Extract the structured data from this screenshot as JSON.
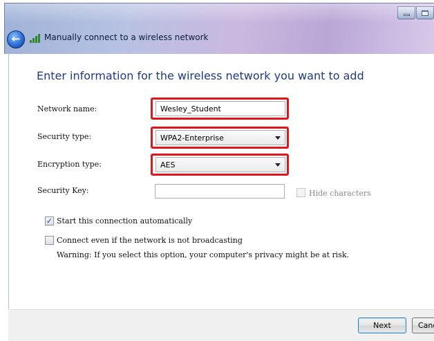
{
  "window": {
    "title": "Manually connect to a wireless network"
  },
  "form": {
    "heading": "Enter information for the wireless network you want to add",
    "network_name": {
      "label": "Network name:",
      "value": "Wesley_Student"
    },
    "security_type": {
      "label": "Security type:",
      "value": "WPA2-Enterprise"
    },
    "encryption_type": {
      "label": "Encryption type:",
      "value": "AES"
    },
    "security_key": {
      "label": "Security Key:",
      "value": ""
    },
    "hide_characters": {
      "label": "Hide characters",
      "checked": false,
      "enabled": false
    },
    "start_auto": {
      "label": "Start this connection automatically",
      "checked": true
    },
    "connect_even": {
      "label": "Connect even if the network is not broadcasting",
      "checked": false
    },
    "warning": "Warning: If you select this option, your computer's privacy might be at risk."
  },
  "footer": {
    "next_label": "Next",
    "cancel_label": "Canc"
  },
  "icons": {
    "back": "back-arrow-icon",
    "network": "wireless-signal-icon",
    "minimize": "minimize-icon",
    "maximize": "maximize-icon"
  },
  "colors": {
    "highlight": "#e0141b",
    "heading": "#1e3a8a"
  }
}
